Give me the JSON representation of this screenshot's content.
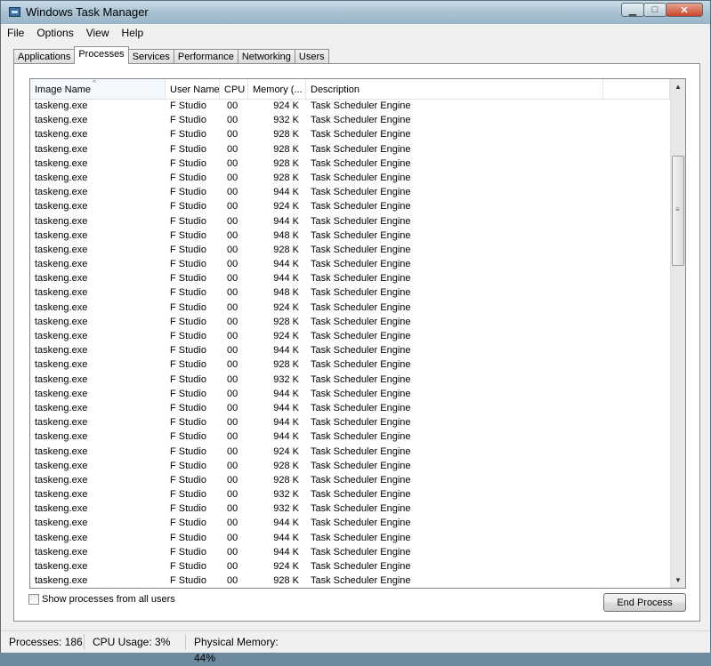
{
  "window": {
    "title": "Windows Task Manager"
  },
  "menu": [
    "File",
    "Options",
    "View",
    "Help"
  ],
  "tabs": [
    "Applications",
    "Processes",
    "Services",
    "Performance",
    "Networking",
    "Users"
  ],
  "active_tab": "Processes",
  "columns": [
    "Image Name",
    "User Name",
    "CPU",
    "Memory (...",
    "Description",
    ""
  ],
  "rows": [
    {
      "image": "taskeng.exe",
      "user": "F Studio",
      "cpu": "00",
      "mem": "924 K",
      "desc": "Task Scheduler Engine"
    },
    {
      "image": "taskeng.exe",
      "user": "F Studio",
      "cpu": "00",
      "mem": "932 K",
      "desc": "Task Scheduler Engine"
    },
    {
      "image": "taskeng.exe",
      "user": "F Studio",
      "cpu": "00",
      "mem": "928 K",
      "desc": "Task Scheduler Engine"
    },
    {
      "image": "taskeng.exe",
      "user": "F Studio",
      "cpu": "00",
      "mem": "928 K",
      "desc": "Task Scheduler Engine"
    },
    {
      "image": "taskeng.exe",
      "user": "F Studio",
      "cpu": "00",
      "mem": "928 K",
      "desc": "Task Scheduler Engine"
    },
    {
      "image": "taskeng.exe",
      "user": "F Studio",
      "cpu": "00",
      "mem": "928 K",
      "desc": "Task Scheduler Engine"
    },
    {
      "image": "taskeng.exe",
      "user": "F Studio",
      "cpu": "00",
      "mem": "944 K",
      "desc": "Task Scheduler Engine"
    },
    {
      "image": "taskeng.exe",
      "user": "F Studio",
      "cpu": "00",
      "mem": "924 K",
      "desc": "Task Scheduler Engine"
    },
    {
      "image": "taskeng.exe",
      "user": "F Studio",
      "cpu": "00",
      "mem": "944 K",
      "desc": "Task Scheduler Engine"
    },
    {
      "image": "taskeng.exe",
      "user": "F Studio",
      "cpu": "00",
      "mem": "948 K",
      "desc": "Task Scheduler Engine"
    },
    {
      "image": "taskeng.exe",
      "user": "F Studio",
      "cpu": "00",
      "mem": "928 K",
      "desc": "Task Scheduler Engine"
    },
    {
      "image": "taskeng.exe",
      "user": "F Studio",
      "cpu": "00",
      "mem": "944 K",
      "desc": "Task Scheduler Engine"
    },
    {
      "image": "taskeng.exe",
      "user": "F Studio",
      "cpu": "00",
      "mem": "944 K",
      "desc": "Task Scheduler Engine"
    },
    {
      "image": "taskeng.exe",
      "user": "F Studio",
      "cpu": "00",
      "mem": "948 K",
      "desc": "Task Scheduler Engine"
    },
    {
      "image": "taskeng.exe",
      "user": "F Studio",
      "cpu": "00",
      "mem": "924 K",
      "desc": "Task Scheduler Engine"
    },
    {
      "image": "taskeng.exe",
      "user": "F Studio",
      "cpu": "00",
      "mem": "928 K",
      "desc": "Task Scheduler Engine"
    },
    {
      "image": "taskeng.exe",
      "user": "F Studio",
      "cpu": "00",
      "mem": "924 K",
      "desc": "Task Scheduler Engine"
    },
    {
      "image": "taskeng.exe",
      "user": "F Studio",
      "cpu": "00",
      "mem": "944 K",
      "desc": "Task Scheduler Engine"
    },
    {
      "image": "taskeng.exe",
      "user": "F Studio",
      "cpu": "00",
      "mem": "928 K",
      "desc": "Task Scheduler Engine"
    },
    {
      "image": "taskeng.exe",
      "user": "F Studio",
      "cpu": "00",
      "mem": "932 K",
      "desc": "Task Scheduler Engine"
    },
    {
      "image": "taskeng.exe",
      "user": "F Studio",
      "cpu": "00",
      "mem": "944 K",
      "desc": "Task Scheduler Engine"
    },
    {
      "image": "taskeng.exe",
      "user": "F Studio",
      "cpu": "00",
      "mem": "944 K",
      "desc": "Task Scheduler Engine"
    },
    {
      "image": "taskeng.exe",
      "user": "F Studio",
      "cpu": "00",
      "mem": "944 K",
      "desc": "Task Scheduler Engine"
    },
    {
      "image": "taskeng.exe",
      "user": "F Studio",
      "cpu": "00",
      "mem": "944 K",
      "desc": "Task Scheduler Engine"
    },
    {
      "image": "taskeng.exe",
      "user": "F Studio",
      "cpu": "00",
      "mem": "924 K",
      "desc": "Task Scheduler Engine"
    },
    {
      "image": "taskeng.exe",
      "user": "F Studio",
      "cpu": "00",
      "mem": "928 K",
      "desc": "Task Scheduler Engine"
    },
    {
      "image": "taskeng.exe",
      "user": "F Studio",
      "cpu": "00",
      "mem": "928 K",
      "desc": "Task Scheduler Engine"
    },
    {
      "image": "taskeng.exe",
      "user": "F Studio",
      "cpu": "00",
      "mem": "932 K",
      "desc": "Task Scheduler Engine"
    },
    {
      "image": "taskeng.exe",
      "user": "F Studio",
      "cpu": "00",
      "mem": "932 K",
      "desc": "Task Scheduler Engine"
    },
    {
      "image": "taskeng.exe",
      "user": "F Studio",
      "cpu": "00",
      "mem": "944 K",
      "desc": "Task Scheduler Engine"
    },
    {
      "image": "taskeng.exe",
      "user": "F Studio",
      "cpu": "00",
      "mem": "944 K",
      "desc": "Task Scheduler Engine"
    },
    {
      "image": "taskeng.exe",
      "user": "F Studio",
      "cpu": "00",
      "mem": "944 K",
      "desc": "Task Scheduler Engine"
    },
    {
      "image": "taskeng.exe",
      "user": "F Studio",
      "cpu": "00",
      "mem": "924 K",
      "desc": "Task Scheduler Engine"
    },
    {
      "image": "taskeng.exe",
      "user": "F Studio",
      "cpu": "00",
      "mem": "928 K",
      "desc": "Task Scheduler Engine"
    }
  ],
  "show_all_label": "Show processes from all users",
  "show_all_checked": false,
  "end_process_label": "End Process",
  "status": {
    "processes": "Processes: 186",
    "cpu": "CPU Usage: 3%",
    "memory": "Physical Memory: 44%"
  },
  "icons": {
    "app": "task-manager-icon",
    "min": "minimize-icon",
    "max": "maximize-icon",
    "close": "close-icon",
    "sort": "sort-ascending-icon",
    "scroll_up": "scroll-up-icon",
    "scroll_down": "scroll-down-icon"
  }
}
